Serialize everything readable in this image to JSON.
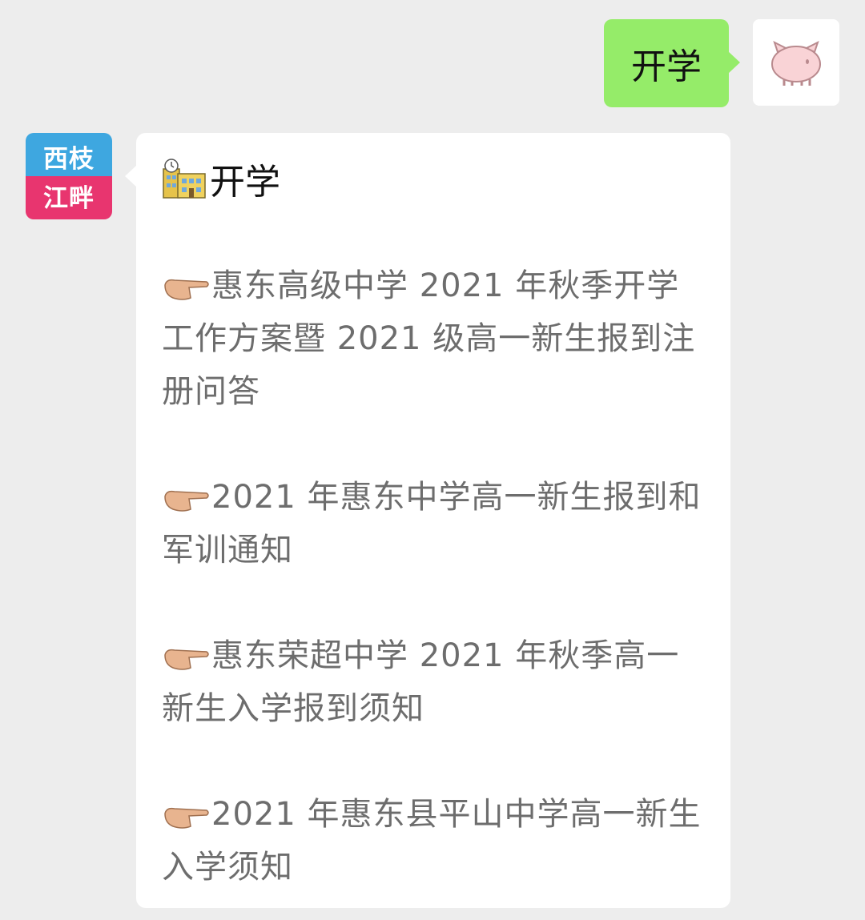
{
  "outgoing_message": {
    "text": "开学"
  },
  "official_account": {
    "avatar_line1": "西枝",
    "avatar_line2": "江畔"
  },
  "reply": {
    "title_icon": "school-building-icon",
    "title": "开学",
    "links": [
      {
        "icon": "pointing-hand-icon",
        "text": "惠东高级中学 2021 年秋季开学工作方案暨 2021 级高一新生报到注册问答"
      },
      {
        "icon": "pointing-hand-icon",
        "text": "2021 年惠东中学高一新生报到和军训通知"
      },
      {
        "icon": "pointing-hand-icon",
        "text": "惠东荣超中学 2021 年秋季高一新生入学报到须知"
      },
      {
        "icon": "pointing-hand-icon",
        "text": "2021 年惠东县平山中学高一新生入学须知"
      }
    ]
  },
  "colors": {
    "outgoing_bubble": "#95ec69",
    "incoming_bubble": "#ffffff",
    "link_text": "#6d6d6d",
    "background": "#ededed"
  }
}
